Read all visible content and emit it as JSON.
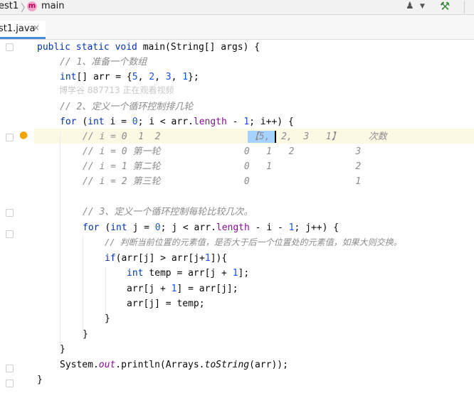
{
  "breadcrumb": {
    "project": "est1",
    "separator": "〉",
    "method_badge": "m",
    "method": "main"
  },
  "toolbar": {
    "user_icon": "user-icon",
    "build_icon": "hammer-icon"
  },
  "tab": {
    "label": "st1.java",
    "close": "×"
  },
  "code": {
    "l1": {
      "a": "public static void ",
      "b": "main(String[] args) {"
    },
    "l2": "// 1、准备一个数组",
    "l3": {
      "a": "int",
      "b": "[] arr = {",
      "n1": "5",
      "c1": ", ",
      "n2": "2",
      "c2": ", ",
      "n3": "3",
      "c3": ", ",
      "n4": "1",
      "end": "};"
    },
    "watermark": "博学谷 887713 正在观看视频",
    "l5": "// 2、定义一个循环控制排几轮",
    "l6": {
      "kw1": "for ",
      "p1": "(",
      "kw2": "int",
      "p2": " i = ",
      "n0": "0",
      "p3": "; i < arr.",
      "field": "length",
      "p4": " - ",
      "n1": "1",
      "p5": "; i++) {"
    },
    "l7": "// i = 0  1  2                【5,  2,  3   1】     次数",
    "l8": "// i = 0 第一轮               0   1   2           3",
    "l9": "// i = 1 第二轮               0   1               2",
    "l10": "// i = 2 第三轮               0                   1",
    "l12": "// 3、定义一个循环控制每轮比较几次。",
    "l13": {
      "kw1": "for ",
      "p1": "(",
      "kw2": "int",
      "p2": " j = ",
      "n0": "0",
      "p3": "; j < arr.",
      "field": "length",
      "p4": " - i - ",
      "n1": "1",
      "p5": "; j++) {"
    },
    "l14": "// 判断当前位置的元素值，是否大于后一个位置处的元素值，如果大则交换。",
    "l15": {
      "kw": "if",
      "a": "(arr[j] > arr[j+",
      "n": "1",
      "b": "]){"
    },
    "l16": {
      "kw": "int",
      "a": " temp = arr[j + ",
      "n": "1",
      "b": "];"
    },
    "l17": {
      "a": "arr[j + ",
      "n": "1",
      "b": "] = arr[j];"
    },
    "l18": "arr[j] = temp;",
    "l19": "}",
    "l20": "}",
    "l21": "}",
    "l22": {
      "a": "System.",
      "field": "out",
      "b": ".println(Arrays.",
      "static": "toString",
      "c": "(arr));"
    },
    "l23": "}"
  }
}
